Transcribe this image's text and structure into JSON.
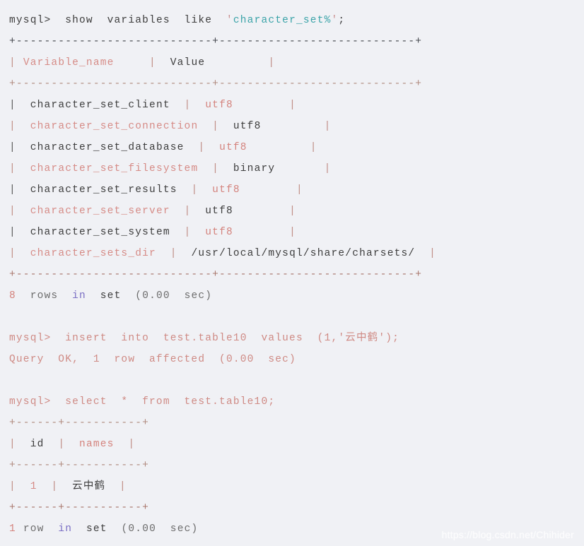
{
  "terminal": {
    "background_color": "#f0f1f5",
    "prompt": "mysql>",
    "block1": {
      "command_parts": {
        "prompt": "mysql>",
        "keywords": "  show  variables  like  ",
        "quote_open": "'",
        "string": "character_set%",
        "quote_close": "'",
        "semicolon": ";"
      },
      "rule_top": "+----------------------------+----------------------------+",
      "rule_header": "+----------------------------+----------------------------+",
      "rule_bottom": "+----------------------------+----------------------------+",
      "header": {
        "col1": "Variable_name",
        "col2": "Value"
      },
      "rows": [
        {
          "name": "character_set_client",
          "value": "utf8",
          "style": "dark-light"
        },
        {
          "name": "character_set_connection",
          "value": "utf8",
          "style": "light-dark"
        },
        {
          "name": "character_set_database",
          "value": "utf8",
          "style": "dark-light"
        },
        {
          "name": "character_set_filesystem",
          "value": "binary",
          "style": "light-dark"
        },
        {
          "name": "character_set_results",
          "value": "utf8",
          "style": "dark-light"
        },
        {
          "name": "character_set_server",
          "value": "utf8",
          "style": "light-dark"
        },
        {
          "name": "character_set_system",
          "value": "utf8",
          "style": "dark-light"
        },
        {
          "name": "character_sets_dir",
          "value": "/usr/local/mysql/share/charsets/",
          "style": "light-dark"
        }
      ],
      "status": {
        "count": "8",
        "rows_word": "rows",
        "in_word": "in",
        "set_word": "set",
        "timing": "(0.00  sec)"
      }
    },
    "block2": {
      "command": "mysql>  insert  into  test.table10  values  (1,'云中鹤');",
      "result": "Query  OK,  1  row  affected  (0.00  sec)"
    },
    "block3": {
      "command": "mysql>  select  *  from  test.table10;",
      "rule": "+------+-----------+",
      "header": {
        "col1": "id",
        "col2": "names"
      },
      "row": {
        "id": "1",
        "names": "云中鹤"
      },
      "status": {
        "count": "1",
        "rows_word": "row",
        "in_word": "in",
        "set_word": "set",
        "timing": "(0.00  sec)"
      }
    }
  },
  "watermark": {
    "text": "https://blog.csdn.net/Chihider"
  }
}
